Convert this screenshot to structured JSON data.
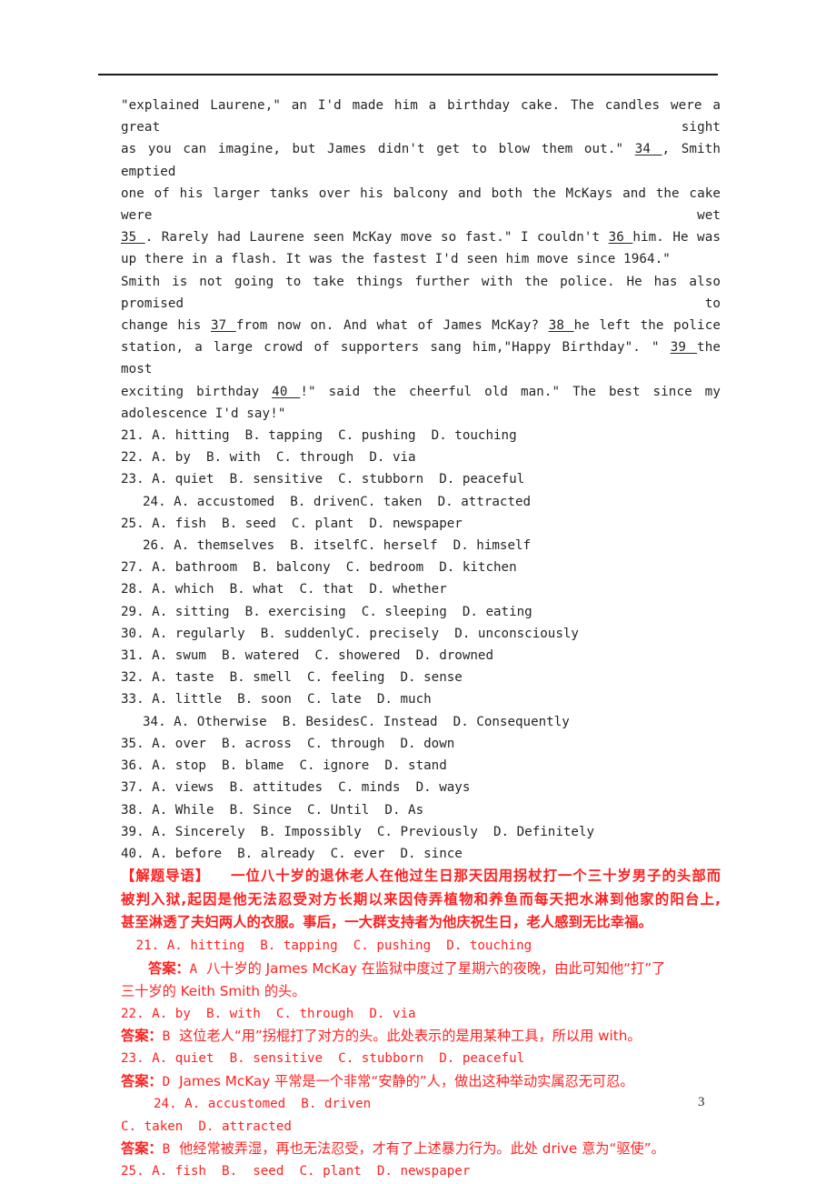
{
  "page": {
    "number": "3",
    "rule_color": "#1a1a1a",
    "red_color": "#ff2020",
    "text_color": "#242424"
  },
  "passage": {
    "paragraph1": [
      "\"explained Laurene,\" an I'd made him a birthday cake. The candles were a great sight",
      "as you can imagine, but James didn't get to blow them out.\"   34  , Smith emptied",
      "one of his larger tanks over his balcony and both the McKays and the cake were wet",
      " 35  . Rarely had Laurene seen McKay move so fast.\" I couldn't   36   him. He was",
      "up there in a flash. It was the fastest I'd seen him move since 1964.\""
    ],
    "paragraph1_blanks": [
      "34",
      "35",
      "36"
    ],
    "paragraph2": [
      "Smith is not going to take things further with the police. He has also promised to",
      "change his   37   from now on. And what of James McKay?   38   he left the police",
      "station, a large crowd of supporters sang him,\"Happy Birthday\". \"  39   the most",
      "exciting birthday   40   !\" said the cheerful old man.\" The best since my",
      "adolescence I'd say!\""
    ],
    "paragraph2_blanks": [
      "37",
      "38",
      "39",
      "40"
    ],
    "line1": "\"explained Laurene,\" an I'd made him a birthday cake. The candles were a great sight",
    "line2_a": "as you can imagine, but James didn't get to blow them out.\"",
    "line2_blank": " 34 ",
    "line2_b": ", Smith emptied",
    "line3": "one of his larger tanks over his balcony and both the McKays and the cake were wet",
    "line4_blank": "35 ",
    "line4_a": ". Rarely had Laurene seen McKay move so fast.\" I couldn't",
    "line4_blank2": " 36 ",
    "line4_b": "him. He was",
    "line5": "up there in a flash. It was the fastest I'd seen him move since 1964.\"",
    "line6": "Smith is not going to take things further with the police. He has also promised to",
    "line7_a": "change his",
    "line7_blank": " 37 ",
    "line7_b": "from now on. And what of James McKay?",
    "line7_blank2": " 38 ",
    "line7_c": "he left the police",
    "line8_a": "station, a large crowd of supporters sang him,\"Happy Birthday\". \"",
    "line8_blank": " 39 ",
    "line8_b": "the most",
    "line9_a": "exciting birthday",
    "line9_blank": " 40 ",
    "line9_b": "!\" said the cheerful old man.\" The best since my",
    "line10": "adolescence I'd say!\""
  },
  "options": [
    {
      "num": "21.",
      "text": "21. A. hitting  B. tapping  C. pushing  D. touching",
      "indent": false
    },
    {
      "num": "22.",
      "text": "22. A. by  B. with  C. through  D. via",
      "indent": false
    },
    {
      "num": "23.",
      "text": "23. A. quiet  B. sensitive  C. stubborn  D. peaceful",
      "indent": false
    },
    {
      "num": "24.",
      "text": "24. A. accustomed  B. drivenC. taken  D. attracted",
      "indent": true
    },
    {
      "num": "25.",
      "text": "25. A. fish  B. seed  C. plant  D. newspaper",
      "indent": false
    },
    {
      "num": "26.",
      "text": "26. A. themselves  B. itselfC. herself  D. himself",
      "indent": true
    },
    {
      "num": "27.",
      "text": "27. A. bathroom  B. balcony  C. bedroom  D. kitchen",
      "indent": false
    },
    {
      "num": "28.",
      "text": "28. A. which  B. what  C. that  D. whether",
      "indent": false
    },
    {
      "num": "29.",
      "text": "29. A. sitting  B. exercising  C. sleeping  D. eating",
      "indent": false
    },
    {
      "num": "30.",
      "text": "30. A. regularly  B. suddenlyC. precisely  D. unconsciously",
      "indent": false
    },
    {
      "num": "31.",
      "text": "31. A. swum  B. watered  C. showered  D. drowned",
      "indent": false
    },
    {
      "num": "32.",
      "text": "32. A. taste  B. smell  C. feeling  D. sense",
      "indent": false
    },
    {
      "num": "33.",
      "text": "33. A. little  B. soon  C. late  D. much",
      "indent": false
    },
    {
      "num": "34.",
      "text": "34. A. Otherwise  B. BesidesC. Instead  D. Consequently",
      "indent": true
    },
    {
      "num": "35.",
      "text": "35. A. over  B. across  C. through  D. down",
      "indent": false
    },
    {
      "num": "36.",
      "text": "36. A. stop  B. blame  C. ignore  D. stand",
      "indent": false
    },
    {
      "num": "37.",
      "text": "37. A. views  B. attitudes  C. minds  D. ways",
      "indent": false
    },
    {
      "num": "38.",
      "text": "38. A. While  B. Since  C. Until  D. As",
      "indent": false
    },
    {
      "num": "39.",
      "text": "39. A. Sincerely  B. Impossibly  C. Previously  D. Definitely",
      "indent": false
    },
    {
      "num": "40.",
      "text": "40. A. before  B. already  C. ever  D. since",
      "indent": false
    }
  ],
  "guide": {
    "tag": "【解题导语】",
    "line1": "一位八十岁的退休老人在他过生日那天因用拐杖打一个三十岁男子的头部而",
    "line2": "被判入狱,起因是他无法忍受对方长期以来因侍弄植物和养鱼而每天把水淋到他家的阳台上,",
    "line3": "甚至淋透了夫妇两人的衣服。事后，一大群支持者为他庆祝生日，老人感到无比幸福。"
  },
  "analysis": [
    {
      "question": " 21. A. hitting  B. tapping  C. pushing  D. touching",
      "q_indent": "ind1",
      "answer_label": "答案：",
      "answer_letter": "A",
      "explain_line1": "八十岁的 James McKay 在监狱中度过了星期六的夜晚，由此可知他“打”了",
      "explain_line2": "三十岁的 Keith Smith 的头。",
      "explain_indent": true
    },
    {
      "question": "22. A. by  B. with  C. through  D. via",
      "q_indent": "",
      "answer_label": "答案：",
      "answer_letter": "B",
      "explain_line1": "这位老人“用”拐棍打了对方的头。此处表示的是用某种工具，所以用 with。",
      "explain_line2": "",
      "explain_indent": false
    },
    {
      "question": "23. A. quiet  B. sensitive  C. stubborn  D. peaceful",
      "q_indent": "",
      "answer_label": "答案：",
      "answer_letter": "D",
      "explain_line1": "James McKay 平常是一个非常“安静的”人，做出这种举动实属忍无可忍。",
      "explain_line2": "",
      "explain_indent": false
    },
    {
      "question": "24. A. accustomed  B. driven",
      "question_cont": "C. taken  D. attracted",
      "q_indent": "ind2",
      "answer_label": "答案：",
      "answer_letter": "B",
      "explain_line1": "他经常被弄湿，再也无法忍受，才有了上述暴力行为。此处 drive 意为“驱使”。",
      "explain_line2": "",
      "explain_indent": false
    },
    {
      "question": "25. A. fish  B.  seed  C. plant  D. newspaper",
      "q_indent": "",
      "answer_label": "",
      "answer_letter": "",
      "explain_line1": "",
      "explain_line2": "",
      "explain_indent": false
    }
  ]
}
